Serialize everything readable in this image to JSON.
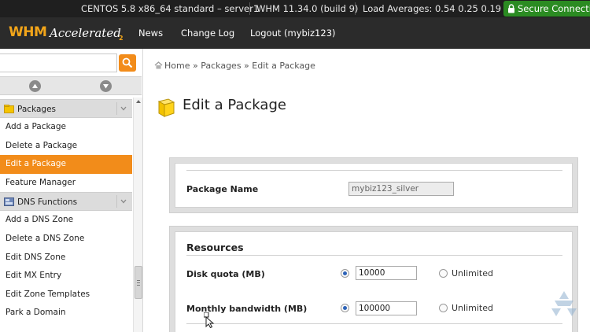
{
  "statusbar": {
    "server": "CENTOS 5.8 x86_64 standard – server1",
    "whm_version": "WHM 11.34.0 (build 9)",
    "load": "Load Averages: 0.54 0.25 0.19",
    "secure": "Secure Connection"
  },
  "header": {
    "logo_whm": "WHM",
    "logo_accelerated": "Accelerated",
    "logo_sub": "2",
    "nav": [
      "News",
      "Change Log",
      "Logout (mybiz123)"
    ]
  },
  "sidebar": {
    "search_value": "",
    "categories": [
      {
        "label": "Packages",
        "items": [
          "Add a Package",
          "Delete a Package",
          "Edit a Package",
          "Feature Manager"
        ],
        "active_item": "Edit a Package"
      },
      {
        "label": "DNS Functions",
        "items": [
          "Add a DNS Zone",
          "Delete a DNS Zone",
          "Edit DNS Zone",
          "Edit MX Entry",
          "Edit Zone Templates",
          "Park a Domain"
        ]
      }
    ]
  },
  "breadcrumb": {
    "home": "Home",
    "sep": "»",
    "packages": "Packages",
    "current": "Edit a Package"
  },
  "page": {
    "title": "Edit a Package"
  },
  "package_panel": {
    "name_label": "Package Name",
    "name_value": "mybiz123_silver"
  },
  "resources_panel": {
    "title": "Resources",
    "disk_label": "Disk quota (MB)",
    "disk_value": "10000",
    "disk_unlimited": "Unlimited",
    "bandwidth_label": "Monthly bandwidth (MB)",
    "bandwidth_value": "100000",
    "bandwidth_unlimited": "Unlimited"
  },
  "colors": {
    "accent": "#f28c1a",
    "secure": "#2b8b22",
    "header": "#2b2b2b",
    "statusbar": "#1f1f1f"
  }
}
